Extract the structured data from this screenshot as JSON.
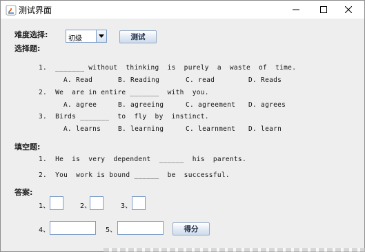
{
  "window": {
    "title": "测试界面",
    "minimize_icon": "minimize-icon",
    "maximize_icon": "maximize-icon",
    "close_icon": "close-icon"
  },
  "difficulty": {
    "label": "难度选择:",
    "selected": "初级",
    "test_button": "测试"
  },
  "choice": {
    "heading": "选择题:",
    "questions": [
      {
        "stem": "1.  _______ without  thinking  is  purely  a  waste  of  time.",
        "options": [
          "A. Read",
          "B. Reading",
          "C. read",
          "D. Reads"
        ]
      },
      {
        "stem": "2.  We  are in entire _______  with  you.",
        "options": [
          "A. agree",
          "B. agreeing",
          "C. agreement",
          "D. agrees"
        ]
      },
      {
        "stem": "3.  Birds _______  to  fly  by  instinct.",
        "options": [
          "A. learns",
          "B. learning",
          "C. learnment",
          "D. learn"
        ]
      }
    ]
  },
  "fill": {
    "heading": "填空题:",
    "questions": [
      "1.  He  is  very  dependent  ______  his  parents.",
      "2.  You  work is bound ______  be  successful."
    ]
  },
  "answers": {
    "heading": "答案:",
    "labels": [
      "1、",
      "2、",
      "3、",
      "4、",
      "5、"
    ],
    "values": [
      "",
      "",
      "",
      "",
      ""
    ],
    "score_button": "得分"
  }
}
